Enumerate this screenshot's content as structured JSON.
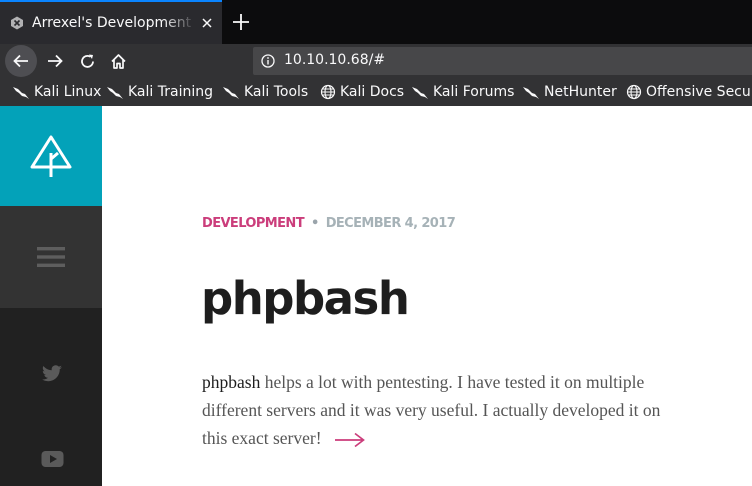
{
  "browser": {
    "tab": {
      "title": "Arrexel's Development Site",
      "favicon": "tab-favicon"
    },
    "new_tab_symbol": "+",
    "nav": {
      "back": "back-arrow-icon",
      "forward": "forward-arrow-icon",
      "reload": "reload-icon",
      "home": "home-icon"
    },
    "url": "10.10.10.68/#",
    "bookmarks": [
      {
        "label": "Kali Linux",
        "icon": "kali-dragon-icon"
      },
      {
        "label": "Kali Training",
        "icon": "kali-dragon-icon"
      },
      {
        "label": "Kali Tools",
        "icon": "kali-dragon-icon"
      },
      {
        "label": "Kali Docs",
        "icon": "globe-icon"
      },
      {
        "label": "Kali Forums",
        "icon": "kali-dragon-icon"
      },
      {
        "label": "NetHunter",
        "icon": "kali-dragon-icon"
      },
      {
        "label": "Offensive Security",
        "icon": "globe-icon"
      }
    ]
  },
  "sidebar": {
    "logo": "site-logo-icon",
    "menu": "hamburger-menu-icon",
    "social": [
      "twitter-icon",
      "youtube-icon"
    ]
  },
  "post": {
    "category": "DEVELOPMENT",
    "separator": "•",
    "date": "DECEMBER 4, 2017",
    "title": "phpbash",
    "excerpt_bold": "phpbash",
    "excerpt_rest": " helps a lot with pentesting. I have tested it on multiple different servers and it was very useful. I actually developed it on this exact server!"
  },
  "colors": {
    "accent_teal": "#03a2b9",
    "category_pink": "#cb3d7b",
    "sidebar_dark": "#212121",
    "tab_active_border": "#0a84ff"
  }
}
